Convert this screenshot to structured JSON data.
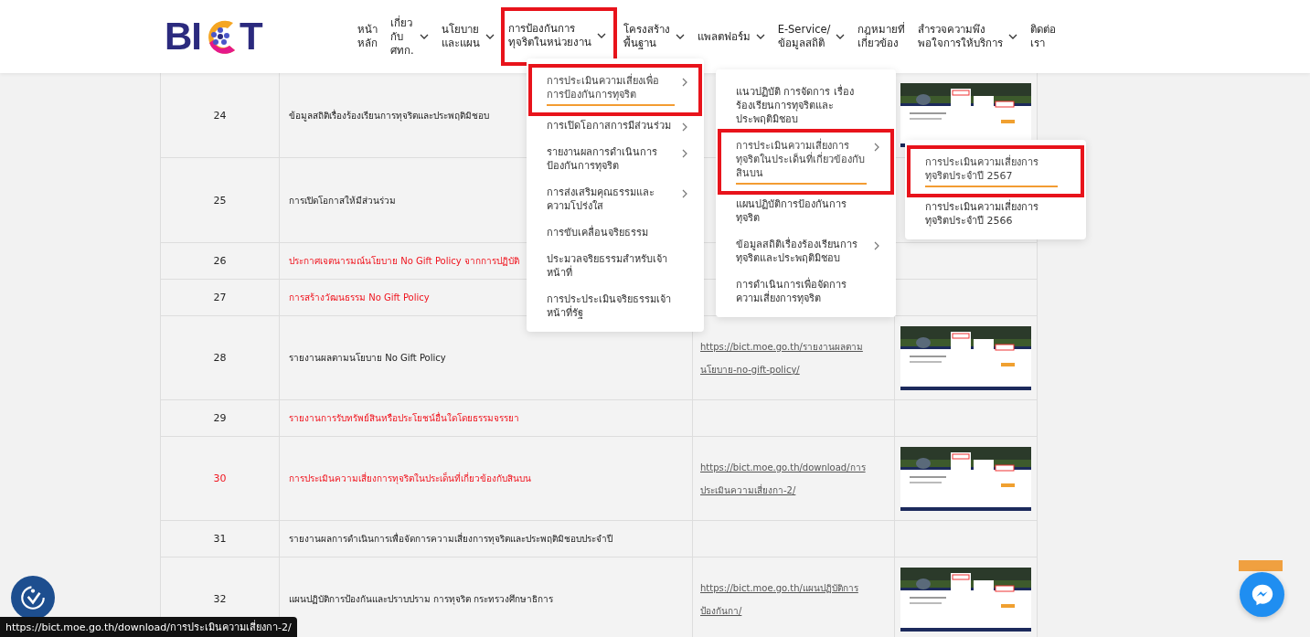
{
  "logo_text": [
    "BI",
    "T"
  ],
  "nav": [
    {
      "lines": [
        "หน้า",
        "หลัก"
      ],
      "dropdown": false,
      "highlighted": false
    },
    {
      "lines": [
        "เกี่ยว",
        "กับ",
        "ศทก."
      ],
      "dropdown": true,
      "highlighted": false
    },
    {
      "lines": [
        "นโยบาย",
        "และแผน"
      ],
      "dropdown": true,
      "highlighted": false
    },
    {
      "lines": [
        "การป้องกันการ",
        "ทุจริตในหน่วยงาน"
      ],
      "dropdown": true,
      "highlighted": true
    },
    {
      "lines": [
        "โครงสร้าง",
        "พื้นฐาน"
      ],
      "dropdown": true,
      "highlighted": false
    },
    {
      "lines": [
        "แพลตฟอร์ม"
      ],
      "dropdown": true,
      "highlighted": false
    },
    {
      "lines": [
        "E-Service/",
        "ข้อมูลสถิติ"
      ],
      "dropdown": true,
      "highlighted": false
    },
    {
      "lines": [
        "กฎหมายที่",
        "เกี่ยวข้อง"
      ],
      "dropdown": false,
      "highlighted": false
    },
    {
      "lines": [
        "สำรวจความพึง",
        "พอใจการให้บริการ"
      ],
      "dropdown": true,
      "highlighted": false
    },
    {
      "lines": [
        "ติดต่อ",
        "เรา"
      ],
      "dropdown": false,
      "highlighted": false
    }
  ],
  "table": {
    "rows": [
      {
        "number": "24",
        "title": "ข้อมูลสถิติเรื่องร้องเรียนการทุจริตและประพฤติมิชอบ",
        "red_number": false,
        "red_title": false,
        "picture": true
      },
      {
        "number": "25",
        "title": "การเปิดโอกาสให้มีส่วนร่วม",
        "red_number": false,
        "red_title": false,
        "picture": false
      },
      {
        "number": "26",
        "title": "ประกาศเจตนารมณ์นโยบาย No Gift Policy จากการปฏิบัติ",
        "red_number": false,
        "red_title": true,
        "picture": false
      },
      {
        "number": "27",
        "title": "การสร้างวัฒนธรรม No Gift Policy",
        "red_number": false,
        "red_title": true,
        "picture": false
      },
      {
        "number": "28",
        "title": "รายงานผลตามนโยบาย No Gift Policy",
        "red_number": false,
        "red_title": false,
        "link": [
          "https://bict.moe.go.th/รายงานผลตาม",
          "นโยบาย-no-gift-policy/"
        ],
        "picture": true
      },
      {
        "number": "29",
        "title": "รายงานการรับทรัพย์สินหรือประโยชน์อื่นใดโดยธรรมจรรยา",
        "red_number": false,
        "red_title": true,
        "picture": false
      },
      {
        "number": "30",
        "title": "การประเมินความเสี่ยงการทุจริตในประเด็นที่เกี่ยวข้องกับสินบน",
        "red_number": true,
        "red_title": true,
        "link": [
          "https://bict.moe.go.th/download/การ",
          "ประเมินความเสี่ยงกา-2/"
        ],
        "picture": true
      },
      {
        "number": "31",
        "title": "รายงานผลการดำเนินการเพื่อจัดการความเสี่ยงการทุจริตและประพฤติมิชอบประจำปี",
        "red_number": false,
        "red_title": false,
        "picture": false
      },
      {
        "number": "32",
        "title": "แผนปฏิบัติการป้องกันและปราบปราม การทุจริต กระทรวงศึกษาธิการ",
        "red_number": false,
        "red_title": false,
        "link": [
          "https://bict.moe.go.th/แผนปฏิบัติการ",
          "ป้องกันกา/"
        ],
        "picture": true
      }
    ]
  },
  "menus": [
    {
      "items": [
        {
          "label": "การประเมินความเสี่ยงเพื่อการป้องกันการทุจริต",
          "submenu": true,
          "selected": true,
          "highlighted": true
        },
        {
          "label": "การเปิดโอกาสการมีส่วนร่วม",
          "submenu": true,
          "selected": false,
          "highlighted": false
        },
        {
          "label": "รายงานผลการดำเนินการป้องกันการทุจริต",
          "submenu": true,
          "selected": false,
          "highlighted": false
        },
        {
          "label": "การส่งเสริมคุณธรรมและความโปร่งใส",
          "submenu": true,
          "selected": false,
          "highlighted": false
        },
        {
          "label": "การขับเคลื่อนจริยธรรม",
          "submenu": false,
          "selected": false,
          "highlighted": false
        },
        {
          "label": "ประมวลจริยธรรมสำหรับเจ้าหน้าที่",
          "submenu": false,
          "selected": false,
          "highlighted": false
        },
        {
          "label": "การประประเมินจริยธรรมเจ้าหน้าที่รัฐ",
          "submenu": false,
          "selected": false,
          "highlighted": false
        }
      ]
    },
    {
      "items": [
        {
          "label": "แนวปฏิบัติ การจัดการ เรื่องร้องเรียนการทุจริตและประพฤติมิชอบ",
          "submenu": false,
          "selected": false,
          "highlighted": false
        },
        {
          "label": "การประเมินความเสี่ยงการทุจริตในประเด็นที่เกี่ยวข้องกับสินบน",
          "submenu": true,
          "selected": true,
          "highlighted": true
        },
        {
          "label": "แผนปฏิบัติการป้องกันการทุจริต",
          "submenu": false,
          "selected": false,
          "highlighted": false
        },
        {
          "label": "ข้อมูลสถิติเรื่องร้องเรียนการทุจริตและประพฤติมิชอบ",
          "submenu": true,
          "selected": false,
          "highlighted": false
        },
        {
          "label": "การดำเนินการเพื่อจัดการความเสี่ยงการทุจริต",
          "submenu": false,
          "selected": false,
          "highlighted": false
        }
      ]
    },
    {
      "items": [
        {
          "label": "การประเมินความเสี่ยงการทุจริตประจำปี 2567",
          "submenu": false,
          "selected": true,
          "highlighted": true
        },
        {
          "label": "การประเมินความเสี่ยงการทุจริตประจำปี 2566",
          "submenu": false,
          "selected": false,
          "highlighted": false
        }
      ]
    }
  ],
  "status_bar": "https://bict.moe.go.th/download/การประเมินความเสี่ยงกา-2/"
}
